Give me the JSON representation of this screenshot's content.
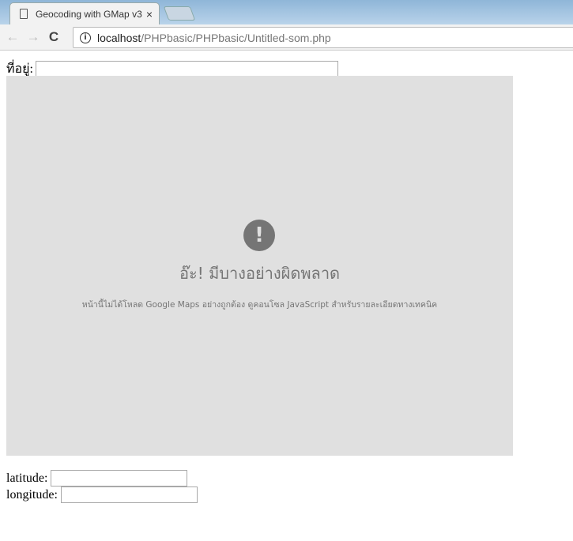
{
  "browser": {
    "tab_title": "Geocoding with GMap v3",
    "close": "×",
    "url_host": "localhost",
    "url_path": "/PHPbasic/PHPbasic/Untitled-som.php",
    "back": "←",
    "forward": "→",
    "reload": "C",
    "info": "i"
  },
  "form": {
    "address_label": "ที่อยู่:",
    "address_value": "",
    "latitude_label": "latitude:",
    "latitude_value": "",
    "longitude_label": "longitude:",
    "longitude_value": ""
  },
  "map_error": {
    "icon": "!",
    "title": "อ๊ะ! มีบางอย่างผิดพลาด",
    "message": "หน้านี้ไม่ได้โหลด Google Maps อย่างถูกต้อง ดูคอนโซล JavaScript สำหรับรายละเอียดทางเทคนิค"
  }
}
